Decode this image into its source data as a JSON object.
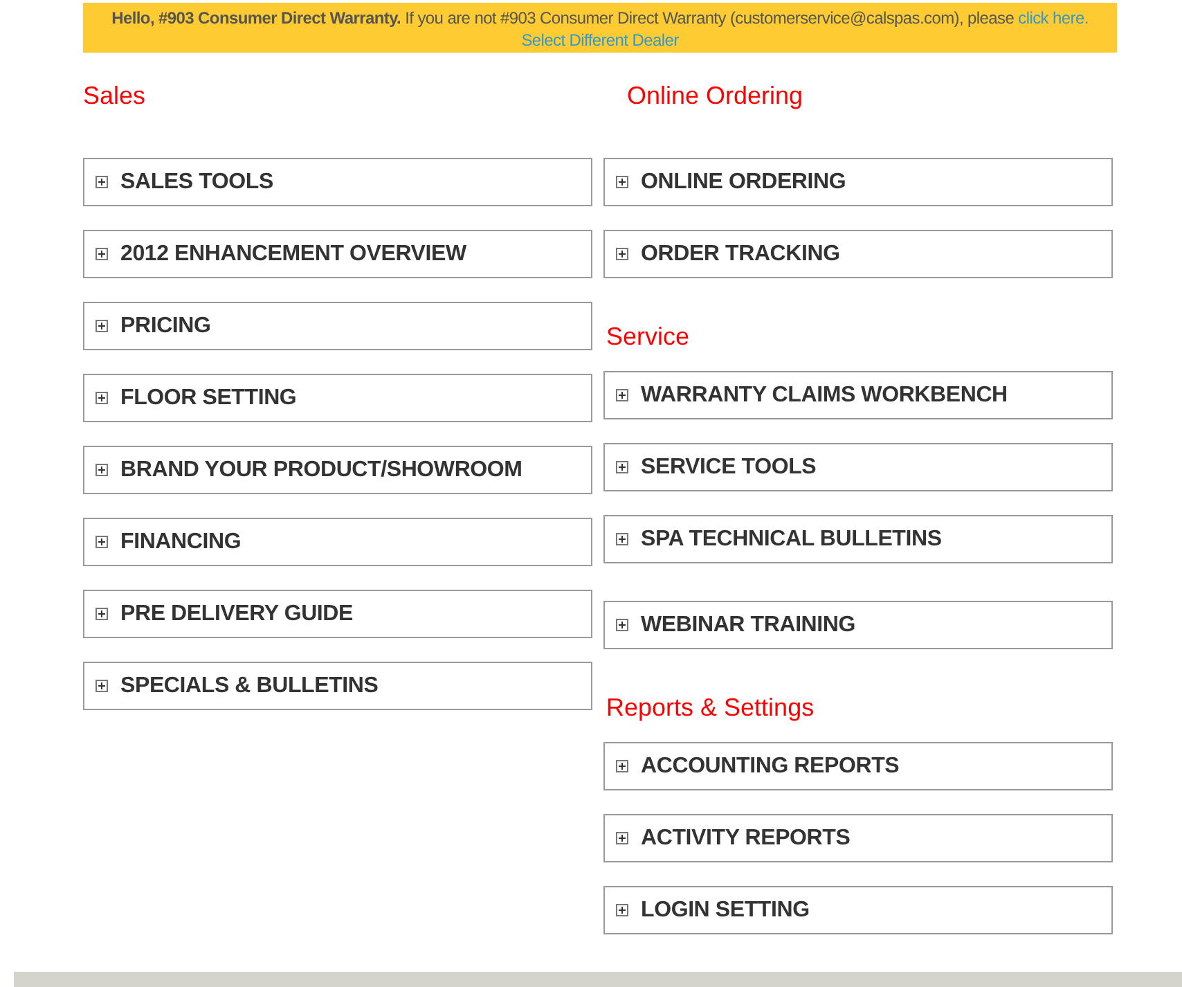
{
  "banner": {
    "message": "**Hello, #903 Consumer Direct Warranty.** If you are not #903 Consumer Direct Warranty (customerservice@calspas.com), please ",
    "link": "click here.",
    "second_link": "Select Different Dealer"
  },
  "left_column": [
    {
      "heading": "Sales",
      "items": [
        {
          "label": "SALES TOOLS",
          "expanded": false
        },
        {
          "label": "2012 ENHANCEMENT OVERVIEW",
          "expanded": false
        },
        {
          "label": "PRICING",
          "expanded": false
        },
        {
          "label": "FLOOR SETTING",
          "expanded": false
        },
        {
          "label": "BRAND YOUR PRODUCT/SHOWROOM",
          "expanded": false
        },
        {
          "label": "FINANCING",
          "expanded": false
        },
        {
          "label": "PRE DELIVERY GUIDE",
          "expanded": false
        },
        {
          "label": "SPECIALS & BULLETINS",
          "expanded": false
        }
      ]
    }
  ],
  "right_column": [
    {
      "heading": "Online Ordering",
      "items": [
        {
          "label": "ONLINE ORDERING",
          "expanded": false
        },
        {
          "label": "ORDER TRACKING",
          "expanded": false
        }
      ]
    },
    {
      "heading": "Service",
      "items": [
        {
          "label": "WARRANTY CLAIMS WORKBENCH",
          "expanded": false
        },
        {
          "label": "SERVICE TOOLS",
          "expanded": false
        },
        {
          "label": "SPA TECHNICAL BULLETINS",
          "expanded": false
        }
      ]
    },
    {
      "items": [
        {
          "label": "WEBINAR TRAINING",
          "expanded": false
        }
      ]
    },
    {
      "heading": "Reports & Settings",
      "items": [
        {
          "label": "ACCOUNTING REPORTS",
          "expanded": false
        },
        {
          "label": "ACTIVITY REPORTS",
          "expanded": false
        },
        {
          "label": "LOGIN SETTING",
          "expanded": false
        }
      ]
    }
  ]
}
